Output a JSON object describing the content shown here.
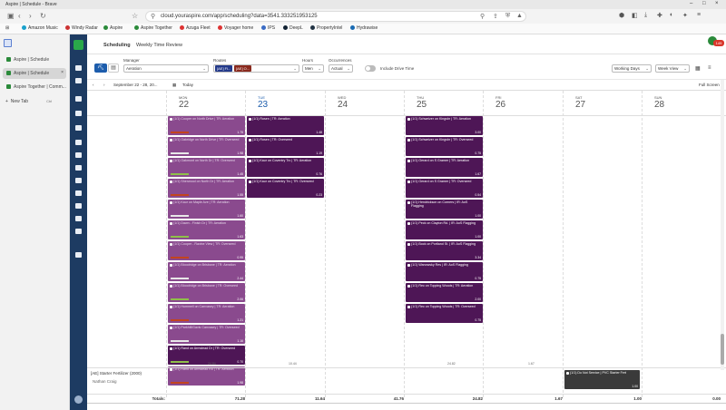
{
  "browser": {
    "window_title": "Aspire | Schedule - Brave",
    "url": "cloud.youraspire.com/app/scheduling?data=3541.333251953125",
    "bookmarks": [
      {
        "label": "Amazon Music",
        "color": "#1aa1cc"
      },
      {
        "label": "Windy Radar",
        "color": "#c33"
      },
      {
        "label": "Aspire",
        "color": "#2a8a3a"
      },
      {
        "label": "Aspire Together",
        "color": "#2a8a3a"
      },
      {
        "label": "Azuga Fleet",
        "color": "#d33"
      },
      {
        "label": "Voyager home",
        "color": "#d33"
      },
      {
        "label": "IPS",
        "color": "#3a6bc4"
      },
      {
        "label": "DeepL",
        "color": "#123"
      },
      {
        "label": "PropertyIntel",
        "color": "#234"
      },
      {
        "label": "Hydrawise",
        "color": "#1a6bb3"
      }
    ],
    "side_tabs": [
      {
        "label": "Aspire | Schedule"
      },
      {
        "label": "Aspire | Schedule"
      },
      {
        "label": "Aspire Together | Comm..."
      }
    ],
    "new_tab": {
      "label": "New Tab",
      "shortcut": "Ctrl"
    }
  },
  "app": {
    "tabs": [
      "Scheduling",
      "Weekly Time Review"
    ],
    "notification_count": "149",
    "filters": {
      "manager_label": "Manager",
      "manager_value": "Aeration",
      "routes_label": "Routes",
      "route_chip_1": "[AE] Fl...",
      "route_chip_2": "[AE] O...",
      "hours_label": "Hours",
      "hours_value": "Men",
      "occurrences_label": "Occurrences",
      "occurrences_value": "Actual",
      "drive_time_label": "Include Drive Time",
      "working_days": "Working Days",
      "week_view": "Week View"
    },
    "date_range": "September 22 - 28, 20...",
    "today_label": "Today",
    "full_screen_label": "Full Screen",
    "days": [
      {
        "name": "MON",
        "num": "22"
      },
      {
        "name": "TUE",
        "num": "23"
      },
      {
        "name": "WED",
        "num": "24"
      },
      {
        "name": "THU",
        "num": "25"
      },
      {
        "name": "FRI",
        "num": "26"
      },
      {
        "name": "SAT",
        "num": "27"
      },
      {
        "name": "SUN",
        "num": "28"
      }
    ],
    "events": {
      "mon": [
        {
          "title": "(1/1) Cooper on North Drive | TR: Aeration",
          "hrs": "1.75",
          "faded": true
        },
        {
          "title": "(1/1) Oakridge on North Drive | TR: Overseed",
          "hrs": "1.98",
          "faded": true
        },
        {
          "title": "(1/1) Oakmont on North Dr | TR: Overseed",
          "hrs": "1.45",
          "faded": true
        },
        {
          "title": "(1/1) Sherwood on North Dr | TR: Aeration",
          "hrs": "1.55",
          "faded": true
        },
        {
          "title": "(1/1) Kaur on Maple Ave | TR: Aeration",
          "hrs": "1.60",
          "faded": true
        },
        {
          "title": "(1/1) Dawn - Finish Dr | TR: Aeration",
          "hrs": "1.63",
          "faded": true
        },
        {
          "title": "(1/1) Cooper - Ravine View | TR: Overseed",
          "hrs": "0.95",
          "faded": true
        },
        {
          "title": "(1/1) Bloodridge on Brisbane | TR: Aeration",
          "hrs": "2.44",
          "faded": true
        },
        {
          "title": "(1/1) Bloodridge on Brisbane | TR: Overseed",
          "hrs": "2.06",
          "faded": true
        },
        {
          "title": "(1/1) Hummell on Canvasey | TR: Aeration",
          "hrs": "1.21",
          "faded": true
        },
        {
          "title": "(1/1) Parkhill/Gavis Canvasey | TR: Overseed",
          "hrs": "1.16",
          "faded": true
        },
        {
          "title": "(1/1) Rand on Armstead Dr | TR: Overseed",
          "hrs": "0.70",
          "faded": false
        },
        {
          "title": "(1/1) Rand on Armstead Rd | TR: Aeration",
          "hrs": "1.98",
          "faded": true
        }
      ],
      "tue": [
        {
          "title": "(1/1) Rosen | TR: Aeration",
          "hrs": "1.48"
        },
        {
          "title": "(1/1) Rosen | TR: Overseed",
          "hrs": "1.19"
        },
        {
          "title": "(1/1) Kaur on Coventry Trc | TR: Aeration",
          "hrs": "0.76"
        },
        {
          "title": "(1/1) Kaur on Coventry Trc | TR: Overseed",
          "hrs": "0.23"
        }
      ],
      "thu": [
        {
          "title": "(1/1) Schweizer on Kingsbr | TR: Aeration",
          "hrs": "3.00"
        },
        {
          "title": "(1/1) Schweizer on Kingsbr | TR: Overseed",
          "hrs": "0.75"
        },
        {
          "title": "(1/1) Gerard on S Gramer | TR: Aeration",
          "hrs": "1.67"
        },
        {
          "title": "(1/1) Gerard on S Gramer | TR: Overseed",
          "hrs": "0.54"
        },
        {
          "title": "(1/1) Hendrickson on Corners | IR: AoS Flagging",
          "hrs": "1.00"
        },
        {
          "title": "(1/1) Peck on Clayton Rd. | IR: AoS Flagging",
          "hrs": "1.00"
        },
        {
          "title": "(1/1) Bock on Portland St. | IR: AoS Flagging",
          "hrs": "3.34"
        },
        {
          "title": "(1/1) Wanowsky Res | IR: AoS Flagging",
          "hrs": "0.75"
        },
        {
          "title": "(1/1) Rec on Topping Woods | TR: Aeration",
          "hrs": "2.00"
        },
        {
          "title": "(1/1) Rec on Topping Woods | TR: Overseed",
          "hrs": "0.75"
        }
      ],
      "sat_bottom": {
        "title": "(1/1) Do Not Service | PVC Starter Fert",
        "hrs": "1.00"
      }
    },
    "day_subtotals": [
      "24.84",
      "10.44",
      "",
      "24.82",
      "1.67",
      "",
      ""
    ],
    "resource_row": {
      "title": "[AE] Starter Fertilizer (2000)",
      "subtitle": "Nathan Craig"
    },
    "totals_label": "Totals:",
    "totals": [
      "71.28",
      "11.64",
      "41.76",
      "24.82",
      "1.67",
      "1.00",
      "0.00"
    ]
  }
}
